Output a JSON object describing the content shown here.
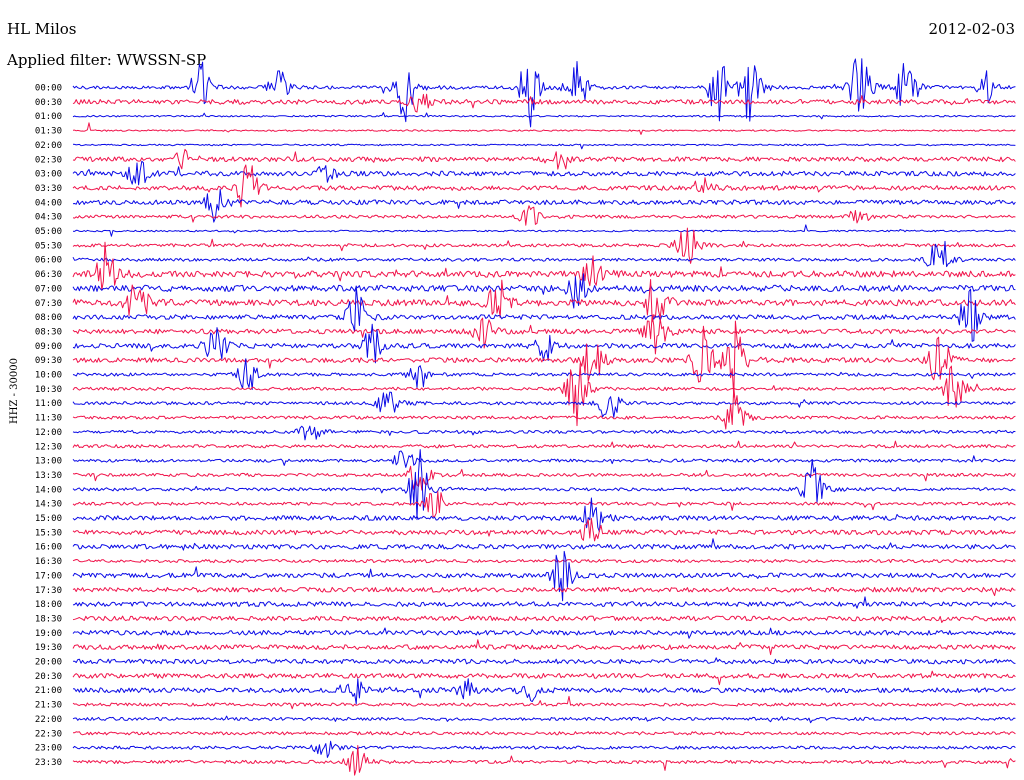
{
  "header": {
    "station": "HL Milos",
    "filter": "Applied filter: WWSSN-SP",
    "date": "2012-02-03",
    "channel": "HHZ - 30000"
  },
  "colors": {
    "trace_a": "#0a0ae6",
    "trace_b": "#f0144b"
  },
  "chart_data": {
    "type": "line",
    "title": "HL Milos",
    "subtitle": "Applied filter: WWSSN-SP",
    "ylabel": "HHZ - 30000",
    "row_labels": [
      "00:00",
      "00:30",
      "01:00",
      "01:30",
      "02:00",
      "02:30",
      "03:00",
      "03:30",
      "04:00",
      "04:30",
      "05:00",
      "05:30",
      "06:00",
      "06:30",
      "07:00",
      "07:30",
      "08:00",
      "08:30",
      "09:00",
      "09:30",
      "10:00",
      "10:30",
      "11:00",
      "11:30",
      "12:00",
      "12:30",
      "13:00",
      "13:30",
      "14:00",
      "14:30",
      "15:00",
      "15:30",
      "16:00",
      "16:30",
      "17:00",
      "17:30",
      "18:00",
      "18:30",
      "19:00",
      "19:30",
      "20:00",
      "20:30",
      "21:00",
      "21:30",
      "22:00",
      "22:30",
      "23:00",
      "23:30"
    ],
    "row_colors": [
      "blue",
      "red",
      "blue",
      "red",
      "blue",
      "red",
      "blue",
      "red",
      "blue",
      "red",
      "blue",
      "red",
      "blue",
      "red",
      "blue",
      "red",
      "blue",
      "red",
      "blue",
      "red",
      "blue",
      "red",
      "blue",
      "red",
      "blue",
      "red",
      "blue",
      "red",
      "blue",
      "red",
      "blue",
      "red",
      "blue",
      "red",
      "blue",
      "red",
      "blue",
      "red",
      "blue",
      "red",
      "blue",
      "red",
      "blue",
      "red",
      "blue",
      "red",
      "blue",
      "red"
    ],
    "minutes_per_row": 30,
    "noise_level": [
      2,
      3,
      1,
      1,
      1,
      3,
      3,
      3,
      3,
      2,
      1,
      2,
      2,
      4,
      4,
      4,
      3,
      3,
      3,
      3,
      2,
      2,
      2,
      2,
      2,
      2,
      2,
      2,
      2,
      2,
      3,
      3,
      3,
      2,
      3,
      3,
      3,
      3,
      3,
      3,
      3,
      3,
      3,
      2,
      2,
      2,
      2,
      2
    ],
    "events": [
      {
        "row": 0,
        "minute": 4,
        "amplitude": 5
      },
      {
        "row": 0,
        "minute": 6.5,
        "amplitude": 4
      },
      {
        "row": 0,
        "minute": 10.5,
        "amplitude": 7
      },
      {
        "row": 0,
        "minute": 14.5,
        "amplitude": 7
      },
      {
        "row": 0,
        "minute": 16,
        "amplitude": 6
      },
      {
        "row": 0,
        "minute": 20.5,
        "amplitude": 6
      },
      {
        "row": 0,
        "minute": 21.5,
        "amplitude": 7
      },
      {
        "row": 0,
        "minute": 25,
        "amplitude": 8
      },
      {
        "row": 0,
        "minute": 26.5,
        "amplitude": 6
      },
      {
        "row": 0,
        "minute": 29,
        "amplitude": 3
      },
      {
        "row": 1,
        "minute": 11,
        "amplitude": 2
      },
      {
        "row": 5,
        "minute": 3.5,
        "amplitude": 2
      },
      {
        "row": 5,
        "minute": 15.5,
        "amplitude": 2
      },
      {
        "row": 6,
        "minute": 2,
        "amplitude": 3
      },
      {
        "row": 6,
        "minute": 8,
        "amplitude": 2
      },
      {
        "row": 7,
        "minute": 5.5,
        "amplitude": 6
      },
      {
        "row": 7,
        "minute": 20,
        "amplitude": 2
      },
      {
        "row": 8,
        "minute": 4.5,
        "amplitude": 4
      },
      {
        "row": 9,
        "minute": 14.5,
        "amplitude": 2
      },
      {
        "row": 9,
        "minute": 25,
        "amplitude": 2
      },
      {
        "row": 11,
        "minute": 19.5,
        "amplitude": 5
      },
      {
        "row": 12,
        "minute": 27.5,
        "amplitude": 4
      },
      {
        "row": 13,
        "minute": 1,
        "amplitude": 5
      },
      {
        "row": 13,
        "minute": 16.5,
        "amplitude": 3
      },
      {
        "row": 14,
        "minute": 16,
        "amplitude": 4
      },
      {
        "row": 15,
        "minute": 2,
        "amplitude": 5
      },
      {
        "row": 15,
        "minute": 13.5,
        "amplitude": 4
      },
      {
        "row": 15,
        "minute": 18.5,
        "amplitude": 6
      },
      {
        "row": 16,
        "minute": 9,
        "amplitude": 5
      },
      {
        "row": 16,
        "minute": 28.5,
        "amplitude": 5
      },
      {
        "row": 17,
        "minute": 13,
        "amplitude": 4
      },
      {
        "row": 17,
        "minute": 18.5,
        "amplitude": 5
      },
      {
        "row": 18,
        "minute": 4.5,
        "amplitude": 4
      },
      {
        "row": 18,
        "minute": 9.5,
        "amplitude": 4
      },
      {
        "row": 18,
        "minute": 15,
        "amplitude": 3
      },
      {
        "row": 19,
        "minute": 16.5,
        "amplitude": 5
      },
      {
        "row": 19,
        "minute": 20,
        "amplitude": 6
      },
      {
        "row": 19,
        "minute": 21,
        "amplitude": 7
      },
      {
        "row": 19,
        "minute": 27.5,
        "amplitude": 5
      },
      {
        "row": 20,
        "minute": 5.5,
        "amplitude": 4
      },
      {
        "row": 20,
        "minute": 11,
        "amplitude": 3
      },
      {
        "row": 21,
        "minute": 16,
        "amplitude": 7
      },
      {
        "row": 21,
        "minute": 28,
        "amplitude": 5
      },
      {
        "row": 22,
        "minute": 10,
        "amplitude": 3
      },
      {
        "row": 22,
        "minute": 17,
        "amplitude": 4
      },
      {
        "row": 23,
        "minute": 21,
        "amplitude": 5
      },
      {
        "row": 24,
        "minute": 7.5,
        "amplitude": 2
      },
      {
        "row": 26,
        "minute": 10.5,
        "amplitude": 2
      },
      {
        "row": 27,
        "minute": 11,
        "amplitude": 4
      },
      {
        "row": 28,
        "minute": 11,
        "amplitude": 7
      },
      {
        "row": 28,
        "minute": 23.5,
        "amplitude": 5
      },
      {
        "row": 29,
        "minute": 11.5,
        "amplitude": 3
      },
      {
        "row": 30,
        "minute": 16.5,
        "amplitude": 4
      },
      {
        "row": 31,
        "minute": 16.5,
        "amplitude": 3
      },
      {
        "row": 34,
        "minute": 15.5,
        "amplitude": 5
      },
      {
        "row": 42,
        "minute": 9,
        "amplitude": 2
      },
      {
        "row": 42,
        "minute": 12.5,
        "amplitude": 2
      },
      {
        "row": 42,
        "minute": 14.5,
        "amplitude": 2
      },
      {
        "row": 46,
        "minute": 8,
        "amplitude": 2
      },
      {
        "row": 47,
        "minute": 9,
        "amplitude": 3
      }
    ]
  }
}
